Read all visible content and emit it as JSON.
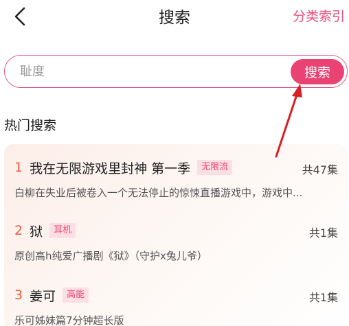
{
  "header": {
    "title": "搜索",
    "category_index": "分类索引",
    "back_icon": "chevron-left-icon"
  },
  "search": {
    "placeholder": "耻度",
    "button_label": "搜索"
  },
  "hot_search": {
    "heading": "热门搜索",
    "items": [
      {
        "rank": "1",
        "title": "我在无限游戏里封神 第一季",
        "tag": "无限流",
        "episodes": "共47集",
        "description": "白柳在失业后被卷入一个无法停止的惊悚直播游戏中，游戏中..."
      },
      {
        "rank": "2",
        "title": "狱",
        "tag": "耳机",
        "episodes": "共1集",
        "description": "原创高h纯爱广播剧《狱》（守护x兔儿爷）"
      },
      {
        "rank": "3",
        "title": "姜可",
        "tag": "高能",
        "episodes": "共1集",
        "description": "乐可姊妹篇7分钟超长版"
      }
    ]
  },
  "colors": {
    "accent": "#ea4272",
    "rank": "#f05a3a",
    "tag_bg": "#fbdfe5",
    "annotation_arrow": "#d91f26"
  }
}
